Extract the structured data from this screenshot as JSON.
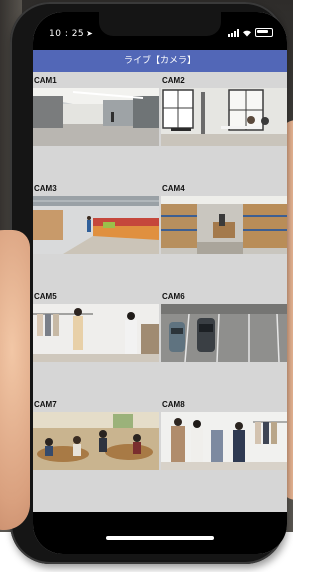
{
  "status_bar": {
    "time": "10 : 25",
    "location_arrow": "➤",
    "icons": [
      "signal-icon",
      "wifi-icon",
      "battery-icon"
    ]
  },
  "header": {
    "title": "ライブ【カメラ】"
  },
  "cameras": [
    {
      "label": "CAM1"
    },
    {
      "label": "CAM2"
    },
    {
      "label": "CAM3"
    },
    {
      "label": "CAM4"
    },
    {
      "label": "CAM5"
    },
    {
      "label": "CAM6"
    },
    {
      "label": "CAM7"
    },
    {
      "label": "CAM8"
    }
  ],
  "colors": {
    "header_bg": "#5267b7",
    "grid_bg": "#d6d6d6",
    "status_bg": "#000000"
  }
}
